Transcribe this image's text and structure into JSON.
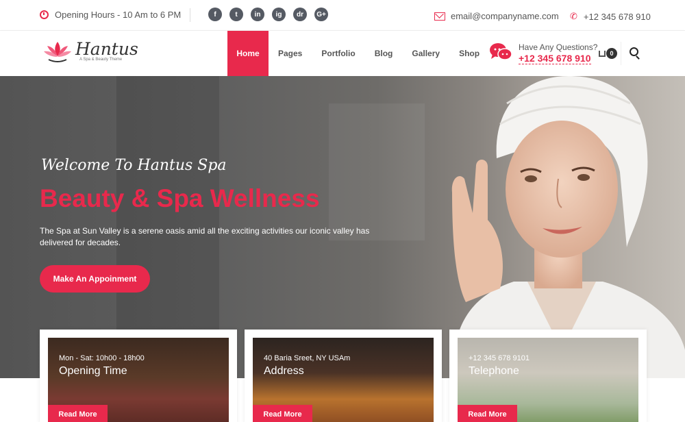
{
  "topbar": {
    "hours": "Opening Hours - 10 Am to 6 PM",
    "socials": [
      "f",
      "t",
      "in",
      "ig",
      "dr",
      "G+"
    ],
    "email": "email@companyname.com",
    "phone": "+12 345 678 910"
  },
  "header": {
    "logo_name": "Hantus",
    "logo_tagline": "A Spa & Beauty Theme",
    "nav": [
      "Home",
      "Pages",
      "Portfolio",
      "Blog",
      "Gallery",
      "Shop"
    ],
    "questions_label": "Have Any Questions?",
    "questions_phone": "+12 345 678 910",
    "cart_count": "0"
  },
  "hero": {
    "welcome": "Welcome To Hantus Spa",
    "title": "Beauty & Spa Wellness",
    "description": "The Spa at Sun Valley is a serene oasis amid all the exciting activities our iconic valley has delivered for decades.",
    "button": "Make An Appoinment"
  },
  "cards": [
    {
      "subtitle": "Mon - Sat: 10h00 - 18h00",
      "title": "Opening Time",
      "button": "Read More"
    },
    {
      "subtitle": "40 Baria Sreet, NY USAm",
      "title": "Address",
      "button": "Read More"
    },
    {
      "subtitle": "+12 345 678 9101",
      "title": "Telephone",
      "button": "Read More"
    }
  ],
  "colors": {
    "accent": "#e8294c",
    "dark_icon": "#555a63"
  }
}
